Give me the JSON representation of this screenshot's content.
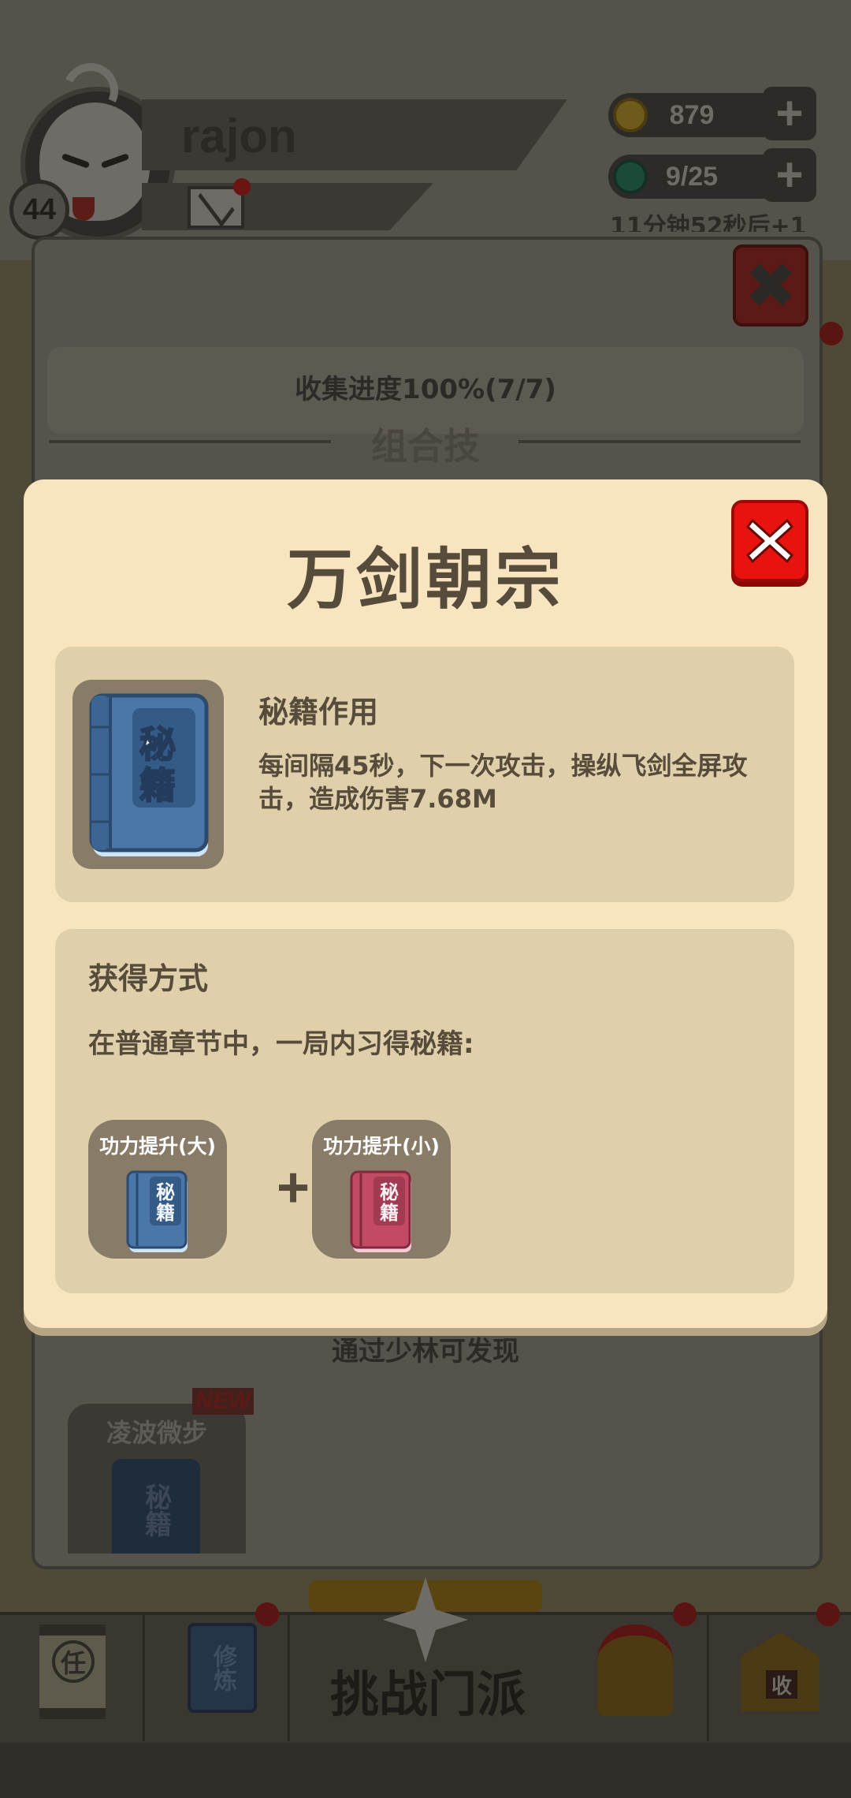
{
  "player": {
    "name": "rajon",
    "level": "44"
  },
  "resources": {
    "coins": "879",
    "energy": "9/25",
    "timer": "11分钟52秒后+1"
  },
  "background": {
    "collect_progress": "收集进度100%(7/7)",
    "combo_heading": "组合技",
    "found_hint": "通过少林可发现",
    "skill_name": "凌波微步",
    "new_tag": "NEW",
    "book_char": "秘籍"
  },
  "bottom_nav": {
    "task_char": "任",
    "train_label": "修炼",
    "challenge_label": "挑战门派",
    "collect_char": "收"
  },
  "modal": {
    "title": "万剑朝宗",
    "book_label_top": "秘",
    "book_label_bottom": "籍",
    "effect_title": "秘籍作用",
    "effect_desc": "每间隔45秒，下一次攻击，操纵飞剑全屏攻击，造成伤害7.68M",
    "method_title": "获得方式",
    "method_desc": "在普通章节中，一局内习得秘籍:",
    "requirements": [
      {
        "name": "功力提升(大)",
        "book_color": "blue",
        "book_label_top": "秘",
        "book_label_bottom": "籍"
      },
      {
        "name": "功力提升(小)",
        "book_color": "pink",
        "book_label_top": "秘",
        "book_label_bottom": "籍"
      }
    ],
    "plus": "+"
  },
  "colors": {
    "modal_bg": "#f8e5c0",
    "panel_bg": "#dfcfaa",
    "text_brown": "#574c3b",
    "close_red": "#e8120e",
    "book_blue": "#4a76a8",
    "book_pink": "#c24a64"
  }
}
